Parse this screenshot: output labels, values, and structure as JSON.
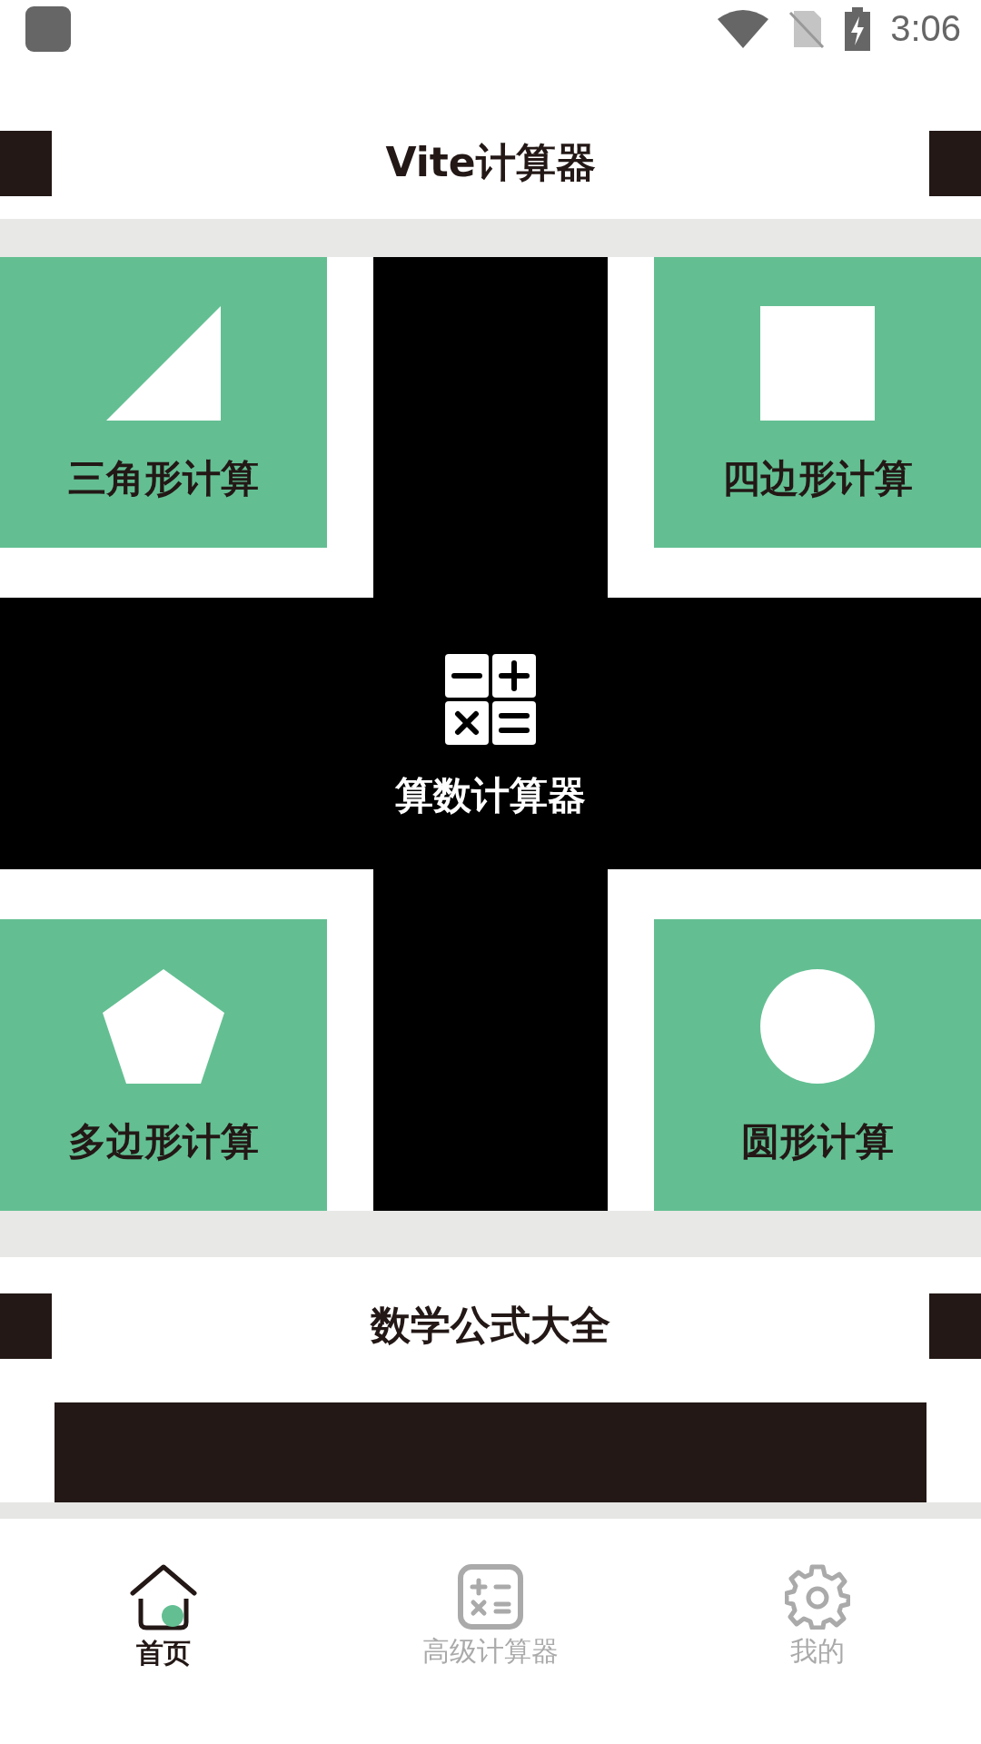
{
  "status_bar": {
    "time": "3:06"
  },
  "header": {
    "title": "Vite计算器"
  },
  "cards": [
    {
      "kind": "triangle",
      "label": "三角形计算"
    },
    {
      "kind": "square",
      "label": "四边形计算"
    },
    {
      "kind": "pentagon",
      "label": "多边形计算"
    },
    {
      "kind": "circle",
      "label": "圆形计算"
    }
  ],
  "center_card": {
    "label": "算数计算器"
  },
  "section": {
    "title": "数学公式大全"
  },
  "bottom_nav": [
    {
      "kind": "home",
      "label": "首页",
      "selected": true
    },
    {
      "kind": "calculator",
      "label": "高级计算器",
      "selected": false
    },
    {
      "kind": "settings",
      "label": "我的",
      "selected": false
    }
  ]
}
